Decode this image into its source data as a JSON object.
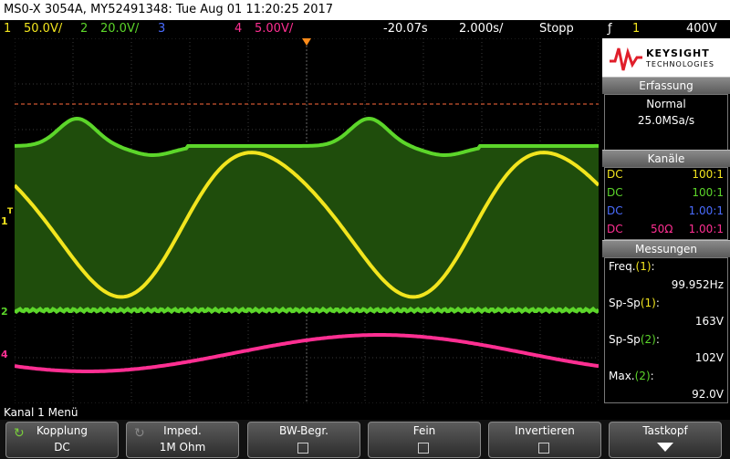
{
  "title": "MS0-X 3054A, MY52491348: Tue Aug 01 11:20:25 2017",
  "channels": [
    {
      "num": "1",
      "scale": "50.0V/",
      "color": "#f2e51e"
    },
    {
      "num": "2",
      "scale": "20.0V/",
      "color": "#5cd62a"
    },
    {
      "num": "3",
      "scale": "",
      "color": "#4a6cff"
    },
    {
      "num": "4",
      "scale": "5.00V/",
      "color": "#ff2f92"
    }
  ],
  "timebase": {
    "delay": "-20.07s",
    "scale": "2.000s/",
    "run_state": "Stopp",
    "trigger_source": "1",
    "trigger_level": "400V"
  },
  "brand": {
    "name": "KEYSIGHT",
    "sub": "TECHNOLOGIES"
  },
  "acquisition": {
    "header": "Erfassung",
    "mode": "Normal",
    "rate": "25.0MSa/s"
  },
  "channels_panel": {
    "header": "Kanäle",
    "rows": [
      {
        "coupling": "DC",
        "imp": "",
        "probe": "100:1",
        "color": "#f2e51e"
      },
      {
        "coupling": "DC",
        "imp": "",
        "probe": "100:1",
        "color": "#5cd62a"
      },
      {
        "coupling": "DC",
        "imp": "",
        "probe": "1.00:1",
        "color": "#4a6cff"
      },
      {
        "coupling": "DC",
        "imp": "50Ω",
        "probe": "1.00:1",
        "color": "#ff2f92"
      }
    ]
  },
  "measurements": {
    "header": "Messungen",
    "items": [
      {
        "label": "Freq.",
        "src": "(1)",
        "value": "99.952Hz",
        "src_color": "#f2e51e"
      },
      {
        "label": "Sp-Sp",
        "src": "(1)",
        "value": "163V",
        "src_color": "#f2e51e"
      },
      {
        "label": "Sp-Sp",
        "src": "(2)",
        "value": "102V",
        "src_color": "#5cd62a"
      },
      {
        "label": "Max.",
        "src": "(2)",
        "value": "92.0V",
        "src_color": "#5cd62a"
      }
    ]
  },
  "menu_title": "Kanal 1 Menü",
  "softkeys": [
    {
      "title": "Kopplung",
      "value": "DC"
    },
    {
      "title": "Imped.",
      "value": "1M Ohm"
    },
    {
      "title": "BW-Begr.",
      "value": ""
    },
    {
      "title": "Fein",
      "value": ""
    },
    {
      "title": "Invertieren",
      "value": ""
    },
    {
      "title": "Tastkopf",
      "value": ""
    }
  ],
  "markers": {
    "ch1": "1",
    "ch1_trig": "T",
    "ch2": "2",
    "ch4": "4"
  },
  "colors": {
    "ch1": "#f2e51e",
    "ch2": "#5cd62a",
    "ch2_fill": "#1f4d0c",
    "ch4": "#ff2f92",
    "grid": "#3a3a3a",
    "trigger_line": "#ff6a3d"
  }
}
